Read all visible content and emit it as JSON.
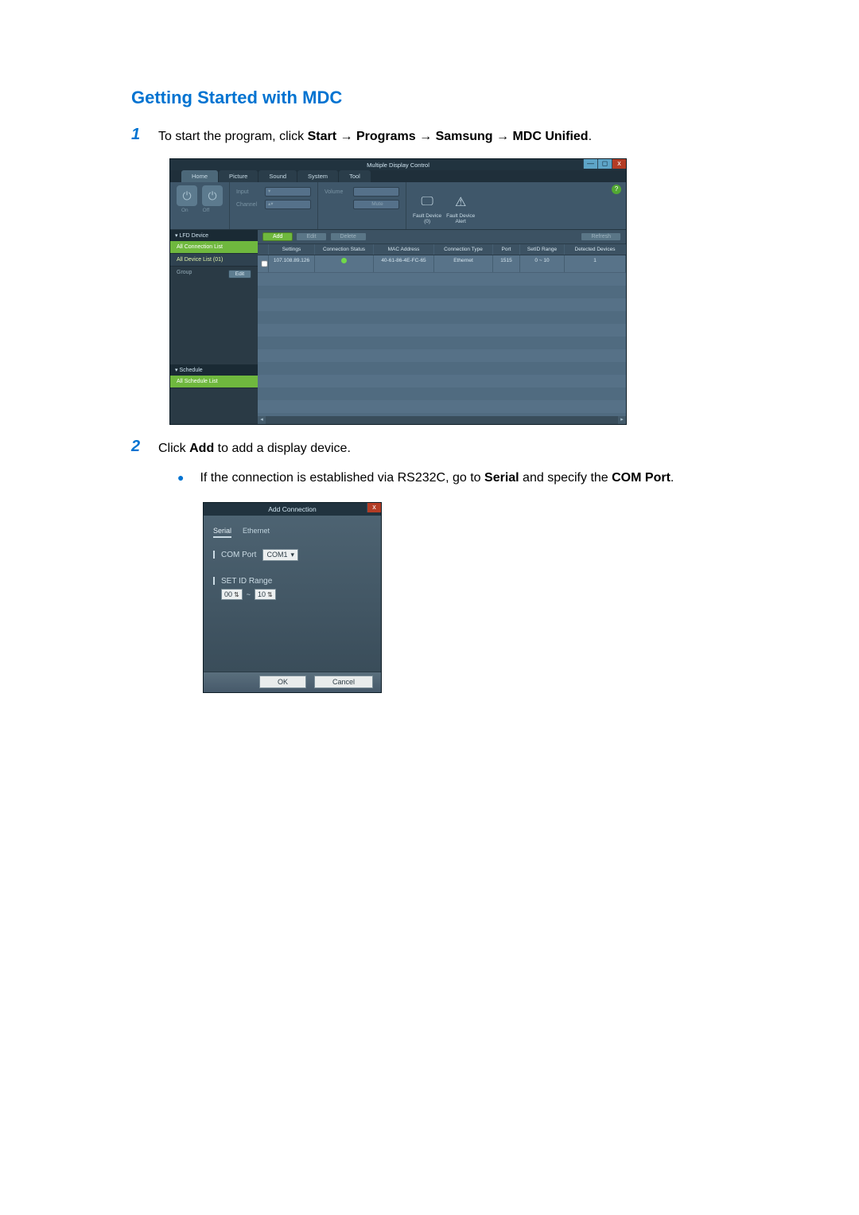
{
  "heading": "Getting Started with MDC",
  "steps": {
    "s1": {
      "num": "1",
      "pre": "To start the program, click ",
      "b1": "Start",
      "arr1": " → ",
      "b2": "Programs",
      "arr2": " → ",
      "b3": "Samsung",
      "arr3": " → ",
      "b4": "MDC Unified",
      "post": "."
    },
    "s2": {
      "num": "2",
      "pre": "Click ",
      "b1": "Add",
      "post": " to add a display device."
    },
    "bullet": {
      "pre": "If the connection is established via RS232C, go to ",
      "b1": "Serial",
      "mid": " and specify the ",
      "b2": "COM Port",
      "post": "."
    }
  },
  "mdc": {
    "title": "Multiple Display Control",
    "win": {
      "min": "—",
      "max": "◻",
      "close": "x"
    },
    "help": "?",
    "tabs": [
      "Home",
      "Picture",
      "Sound",
      "System",
      "Tool"
    ],
    "power": {
      "on": "On",
      "off": "Off"
    },
    "input": {
      "lbl": "Input"
    },
    "channel": {
      "lbl": "Channel"
    },
    "volume": {
      "lbl": "Volume",
      "mute": "Mute"
    },
    "fault": {
      "devn": "Fault Device\n(0)",
      "alert": "Fault Device\nAlert"
    },
    "side": {
      "lfd": "LFD Device",
      "allconn": "All Connection List",
      "alldev": "All Device List (01)",
      "group": "Group",
      "edit": "Edit",
      "sched": "Schedule",
      "allsched": "All Schedule List"
    },
    "tool": {
      "add": "Add",
      "editb": "Edit",
      "del": "Delete",
      "refresh": "Refresh"
    },
    "thead": [
      "",
      "Settings",
      "Connection Status",
      "MAC Address",
      "Connection Type",
      "Port",
      "SetID Range",
      "Detected Devices"
    ],
    "row": {
      "settings": "107.108.89.126",
      "mac": "40-61-86-4E-FC-65",
      "ctype": "Ethernet",
      "port": "1515",
      "range": "0 ~ 10",
      "det": "1"
    }
  },
  "dlg": {
    "title": "Add Connection",
    "close": "x",
    "tabs": {
      "serial": "Serial",
      "eth": "Ethernet"
    },
    "comport": {
      "lbl": "COM Port",
      "val": "COM1"
    },
    "setid": {
      "lbl": "SET ID Range",
      "from": "00",
      "sep": "~",
      "to": "10"
    },
    "ok": "OK",
    "cancel": "Cancel"
  }
}
